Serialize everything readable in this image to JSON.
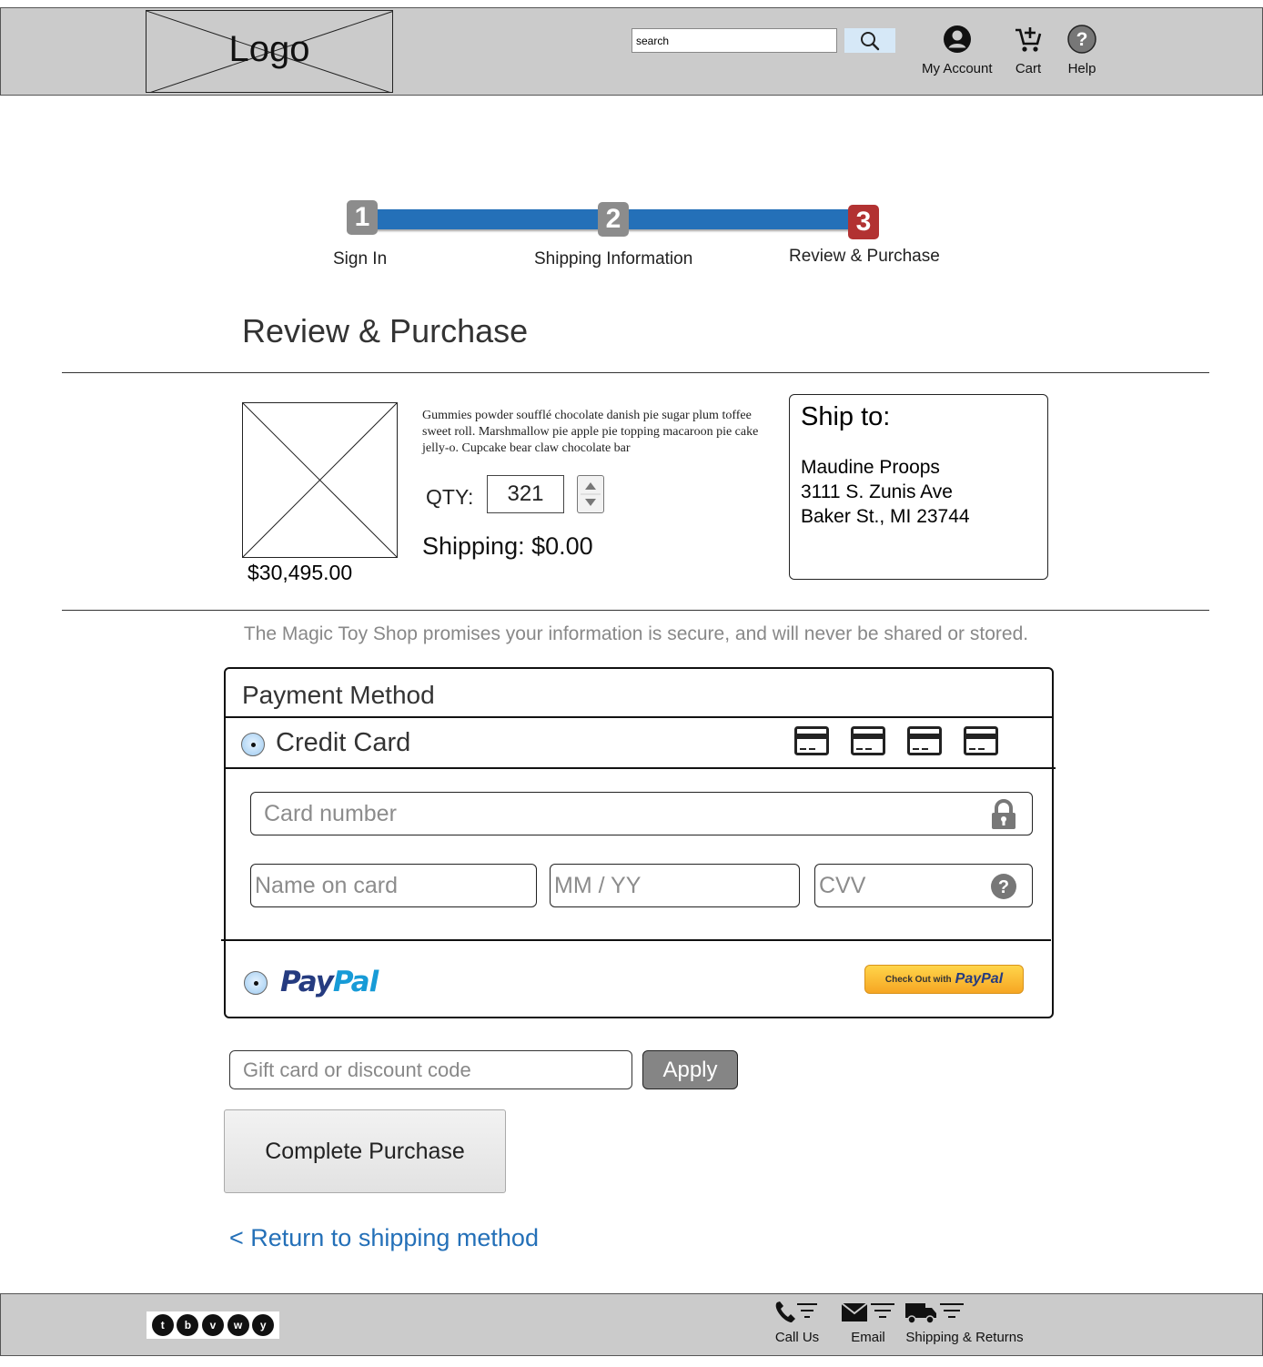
{
  "header": {
    "logo_text": "Logo",
    "search_placeholder": "search",
    "nav": [
      {
        "label": "My Account",
        "icon": "account-icon"
      },
      {
        "label": "Cart",
        "icon": "cart-icon"
      },
      {
        "label": "Help",
        "icon": "help-icon"
      }
    ]
  },
  "stepper": {
    "steps": [
      {
        "number": "1",
        "label": "Sign In",
        "state": "done"
      },
      {
        "number": "2",
        "label": "Shipping Information",
        "state": "done"
      },
      {
        "number": "3",
        "label": "Review & Purchase",
        "state": "current"
      }
    ],
    "colors": {
      "bar": "#2470b8",
      "done": "#8c8c8c",
      "current": "#b23232"
    }
  },
  "page": {
    "title": "Review & Purchase"
  },
  "product": {
    "price": "$30,495.00",
    "description": "Gummies powder soufflé chocolate danish pie sugar plum toffee sweet roll. Marshmallow pie apple pie topping macaroon pie cake jelly-o. Cupcake bear claw chocolate bar",
    "qty_label": "QTY:",
    "qty_value": "321",
    "shipping": "Shipping: $0.00"
  },
  "ship_to": {
    "title": "Ship to:",
    "name": "Maudine Proops",
    "address1": "3111 S. Zunis Ave",
    "address2": "Baker St., MI 23744"
  },
  "secure_note": "The Magic Toy Shop promises your information is secure, and will never be shared or stored.",
  "payment": {
    "title": "Payment Method",
    "credit_card_label": "Credit Card",
    "card_number_placeholder": "Card number",
    "name_placeholder": "Name on card",
    "expiry_placeholder": "MM / YY",
    "cvv_placeholder": "CVV",
    "paypal_pay": "Pay",
    "paypal_pal": "Pal",
    "paypal_button_prefix": "Check Out with",
    "paypal_button_brand": "PayPal"
  },
  "gift_code": {
    "placeholder": "Gift card or discount code",
    "apply_label": "Apply"
  },
  "complete_label": "Complete Purchase",
  "return_link": "< Return to shipping method",
  "footer": {
    "social": [
      "t",
      "b",
      "v",
      "w",
      "y"
    ],
    "links": [
      {
        "label": "Call Us",
        "icon": "phone-icon"
      },
      {
        "label": "Email",
        "icon": "email-icon"
      },
      {
        "label": "Shipping & Returns",
        "icon": "truck-icon"
      }
    ]
  }
}
